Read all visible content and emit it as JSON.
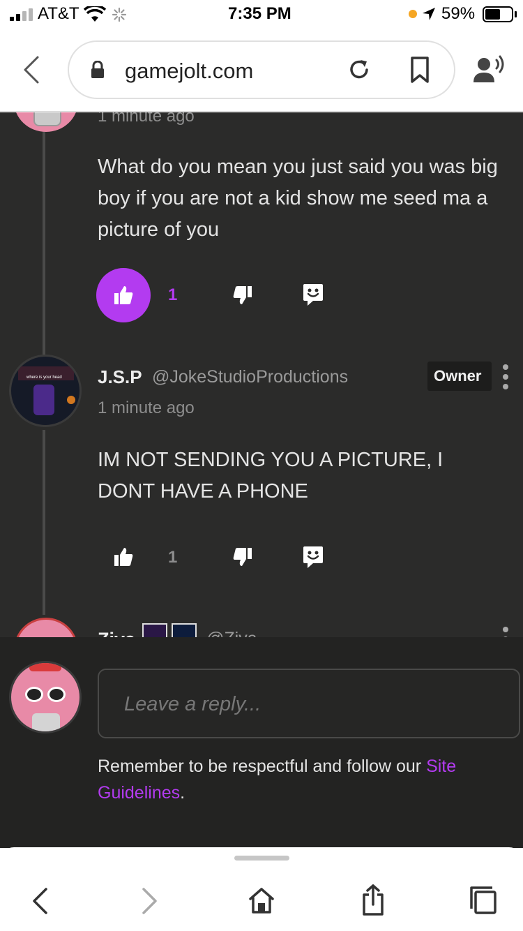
{
  "status": {
    "carrier": "AT&T",
    "time": "7:35 PM",
    "battery": "59%",
    "battery_level": 0.59,
    "recording_dot_color": "#f5a623"
  },
  "browser": {
    "url": "gamejolt.com",
    "icons": [
      "back-icon",
      "lock-icon",
      "reload-icon",
      "bookmark-icon",
      "reader-voice-icon"
    ]
  },
  "comments": [
    {
      "time": "1 minute ago",
      "text": "What do you mean you just said you was big boy if you are not a kid show me seed ma a picture of you",
      "likes": "1",
      "liked": true
    },
    {
      "name": "J.S.P",
      "handle": "@JokeStudioProductions",
      "badge": "Owner",
      "avatar_caption": "where is your head",
      "time": "1 minute ago",
      "text": "IM NOT SENDING YOU A PICTURE, I DONT HAVE A PHONE",
      "likes": "1",
      "liked": false
    },
    {
      "name": "Ziva",
      "handle": "@Ziva"
    }
  ],
  "reply": {
    "placeholder": "Leave a reply...",
    "notice_prefix": "Remember to be respectful and follow our ",
    "notice_link": "Site Guidelines",
    "notice_suffix": "."
  },
  "colors": {
    "accent": "#b33bf0",
    "background": "#2b2b2a",
    "reply_background": "#232322"
  }
}
